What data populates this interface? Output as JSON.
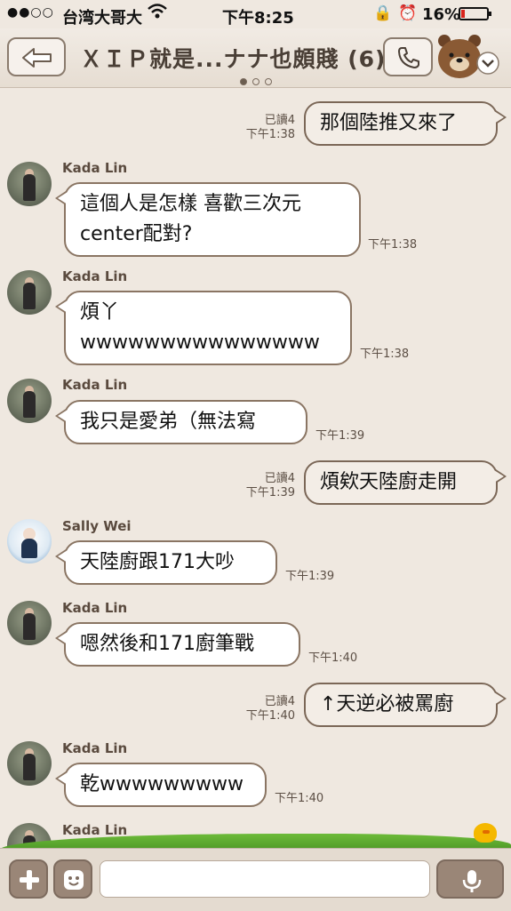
{
  "status_bar": {
    "signal": "●●○○",
    "carrier": "台湾大哥大",
    "time": "下午8:25",
    "battery": "16%",
    "battery_level": 0.16
  },
  "header": {
    "title": "ＸＩＰ就是...ナナ也頗賤 (6)",
    "page_indicator": {
      "count": 3,
      "active": 0
    }
  },
  "messages": [
    {
      "dir": "out",
      "text": "那個陸推又來了",
      "read": "已讀4",
      "time": "下午1:38"
    },
    {
      "dir": "in",
      "sender": "Kada Lin",
      "lines": [
        "這個人是怎樣 喜歡三次元",
        "center配對?"
      ],
      "time": "下午1:38"
    },
    {
      "dir": "in",
      "sender": "Kada Lin",
      "lines": [
        "煩丫",
        "wwwwwwwwwwwwwww"
      ],
      "time": "下午1:38"
    },
    {
      "dir": "in",
      "sender": "Kada Lin",
      "text": "我只是愛弟（無法寫",
      "time": "下午1:39"
    },
    {
      "dir": "out",
      "text": "煩欸天陸廚走開",
      "read": "已讀4",
      "time": "下午1:39"
    },
    {
      "dir": "in",
      "sender": "Sally Wei",
      "text": "天陸廚跟171大吵",
      "time": "下午1:39"
    },
    {
      "dir": "in",
      "sender": "Kada Lin",
      "text": "嗯然後和171廚筆戰",
      "time": "下午1:40"
    },
    {
      "dir": "out",
      "text": "↑天逆必被罵廚",
      "read": "已讀4",
      "time": "下午1:40"
    },
    {
      "dir": "in",
      "sender": "Kada Lin",
      "text": "乾wwwwwwwww",
      "time": "下午1:40"
    },
    {
      "dir": "in",
      "sender": "Kada Lin"
    }
  ],
  "input_bar": {
    "placeholder": "",
    "buttons": [
      "plus-icon",
      "sticker-icon",
      "mic-icon"
    ]
  },
  "colors": {
    "background": "#efe8e0",
    "bubble_border": "#8a7563",
    "grass": "#5aa82e",
    "battery_low": "#d9241c"
  }
}
